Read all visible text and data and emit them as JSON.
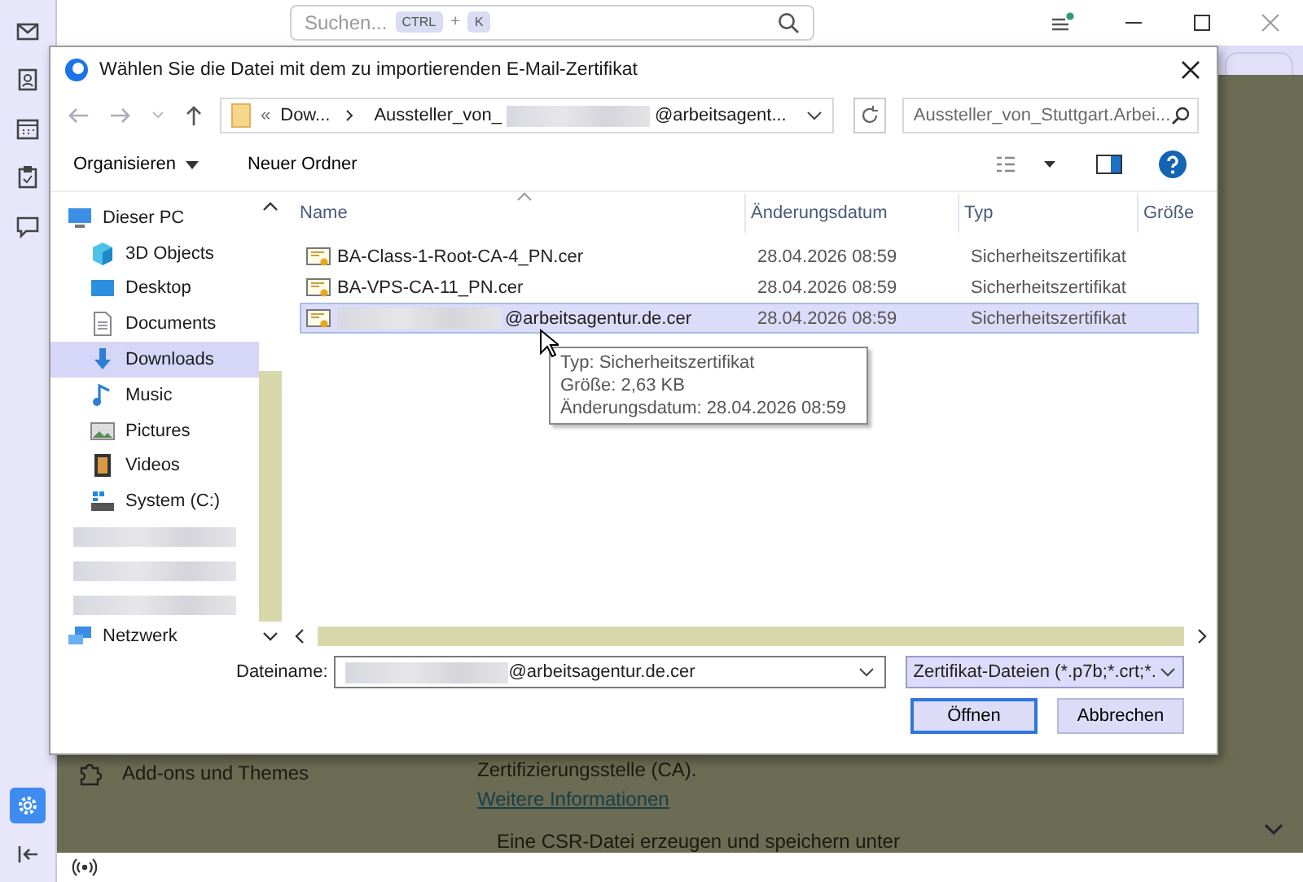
{
  "app": {
    "search": {
      "placeholder": "Suchen...",
      "keys": [
        {
          "label": "CTRL",
          "kind": "key"
        },
        {
          "label": "+",
          "kind": "plus"
        },
        {
          "label": "K",
          "kind": "key"
        }
      ]
    },
    "sidebar": [
      {
        "selected": false
      },
      {
        "selected": false
      },
      {
        "selected": false
      },
      {
        "selected": false
      },
      {
        "selected": false
      },
      {
        "selected": true
      },
      {
        "selected": false
      }
    ],
    "page": {
      "addons": "Add-ons und Themes",
      "ca_text": "Zertifizierungsstelle (CA).",
      "link": "Weitere Informationen",
      "csr_text": "Eine CSR-Datei erzeugen und speichern unter"
    }
  },
  "dialog": {
    "title": "Wählen Sie die Datei mit dem zu importierenden E-Mail-Zertifikat",
    "address": {
      "overflow": "«",
      "segments": [
        {
          "prefix": "Dow..."
        },
        {
          "prefix": "Aussteller_von_",
          "redacted": true,
          "suffix": "@arbeitsagent..."
        }
      ]
    },
    "search": {
      "placeholder": "Aussteller_von_Stuttgart.Arbei..."
    },
    "toolbar": {
      "organize": "Organisieren",
      "new_folder": "Neuer Ordner"
    },
    "nav": [
      {
        "label": "Dieser PC",
        "kind": "pc",
        "selected": false
      },
      {
        "label": "3D Objects",
        "kind": "objects",
        "selected": false
      },
      {
        "label": "Desktop",
        "kind": "desktop",
        "selected": false
      },
      {
        "label": "Documents",
        "kind": "documents",
        "selected": false
      },
      {
        "label": "Downloads",
        "kind": "downloads",
        "selected": true
      },
      {
        "label": "Music",
        "kind": "music",
        "selected": false
      },
      {
        "label": "Pictures",
        "kind": "pictures",
        "selected": false
      },
      {
        "label": "Videos",
        "kind": "videos",
        "selected": false
      },
      {
        "label": "System (C:)",
        "kind": "drive",
        "selected": false
      },
      {
        "kind": "redacted"
      },
      {
        "kind": "redacted"
      },
      {
        "kind": "redacted"
      }
    ],
    "network": {
      "label": "Netzwerk"
    },
    "columns": [
      "Name",
      "Änderungsdatum",
      "Typ",
      "Größe"
    ],
    "files": [
      {
        "name": "BA-Class-1-Root-CA-4_PN.cer",
        "redacted": false,
        "date": "28.04.2026 08:59",
        "type": "Sicherheitszertifikat",
        "selected": false
      },
      {
        "name": "BA-VPS-CA-11_PN.cer",
        "redacted": false,
        "date": "28.04.2026 08:59",
        "type": "Sicherheitszertifikat",
        "selected": false
      },
      {
        "name": "@arbeitsagentur.de.cer",
        "redacted": true,
        "date": "28.04.2026 08:59",
        "type": "Sicherheitszertifikat",
        "selected": true
      }
    ],
    "tooltip": [
      "Typ: Sicherheitszertifikat",
      "Größe: 2,63 KB",
      "Änderungsdatum: 28.04.2026 08:59"
    ],
    "filename": {
      "label": "Dateiname:",
      "value": "@arbeitsagentur.de.cer",
      "redacted": true
    },
    "filter": "Zertifikat-Dateien (*.p7b;*.crt;*.",
    "buttons": [
      {
        "label": "Öffnen",
        "kind": "default"
      },
      {
        "label": "Abbrechen",
        "kind": "normal"
      }
    ]
  }
}
